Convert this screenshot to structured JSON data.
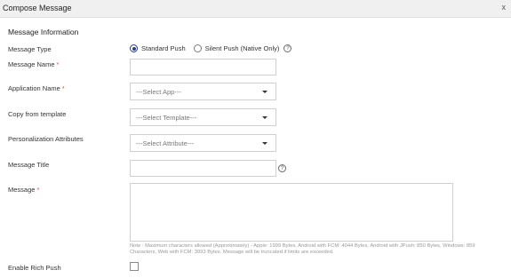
{
  "modal": {
    "title": "Compose Message",
    "close_label": "x"
  },
  "section": {
    "title": "Message Information"
  },
  "fields": {
    "message_type": {
      "label": "Message Type",
      "options": [
        {
          "label": "Standard Push",
          "selected": true
        },
        {
          "label": "Silent Push (Native Only)",
          "selected": false
        }
      ],
      "help": "?"
    },
    "message_name": {
      "label": "Message Name",
      "required": "*",
      "value": ""
    },
    "application_name": {
      "label": "Application Name",
      "required": "*",
      "selected": "---Select App---"
    },
    "copy_template": {
      "label": "Copy from template",
      "selected": "---Select Template---"
    },
    "personalization": {
      "label": "Personalization Attributes",
      "selected": "---Select Attribute---"
    },
    "message_title": {
      "label": "Message Title",
      "value": "",
      "help": "?"
    },
    "message": {
      "label": "Message",
      "required": "*",
      "value": "",
      "note": "Note : Maximum characters allowed (Approximately) - Apple: 1999 Bytes, Android with FCM: 4044 Bytes, Android with JPush: 850 Bytes, Windows: 859 Characters, Web with FCM: 3993 Bytes. Message will be truncated if limits are exceeded."
    },
    "rich_push": {
      "label": "Enable Rich Push",
      "checked": false
    }
  },
  "colors": {
    "accent": "#2c3e8c",
    "required": "#d9534f",
    "titlebar_bg": "#f0f0f0"
  }
}
